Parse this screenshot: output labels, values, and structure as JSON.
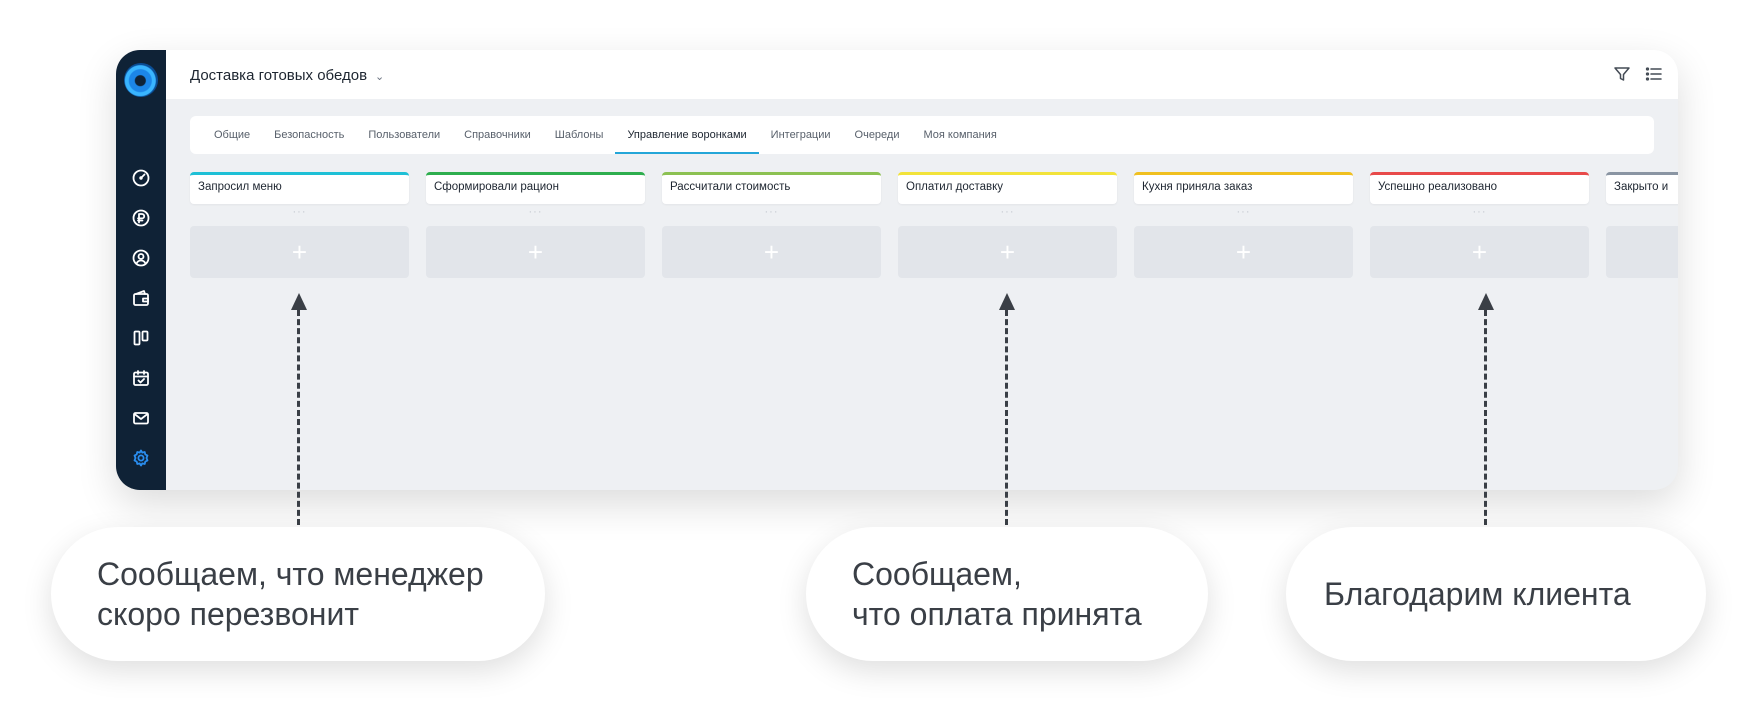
{
  "app": {
    "title": "Доставка готовых обедов",
    "title_caret": "⌄",
    "sidebar_icons": [
      "dashboard-icon",
      "ruble-icon",
      "user-icon",
      "wallet-icon",
      "kanban-icon",
      "calendar-icon",
      "mail-icon",
      "gear-icon"
    ],
    "active_sidebar_icon": "gear-icon",
    "top_icons": [
      "filter-icon",
      "list-icon"
    ]
  },
  "tabs": [
    {
      "label": "Общие"
    },
    {
      "label": "Безопасность"
    },
    {
      "label": "Пользователи"
    },
    {
      "label": "Справочники"
    },
    {
      "label": "Шаблоны"
    },
    {
      "label": "Управление воронками",
      "active": true
    },
    {
      "label": "Интеграции"
    },
    {
      "label": "Очереди"
    },
    {
      "label": "Моя компания"
    }
  ],
  "pipeline": {
    "dots": "···",
    "add_symbol": "+",
    "stages": [
      {
        "label": "Запросил меню",
        "color": "#1ec0d6"
      },
      {
        "label": "Сформировали рацион",
        "color": "#2eae4e"
      },
      {
        "label": "Рассчитали стоимость",
        "color": "#8cc152"
      },
      {
        "label": "Оплатил доставку",
        "color": "#f2e33a"
      },
      {
        "label": "Кухня приняла заказ",
        "color": "#f0c020"
      },
      {
        "label": "Успешно реализовано",
        "color": "#e84a4a"
      },
      {
        "label": "Закрыто и",
        "color": "#8a95a3"
      }
    ]
  },
  "annotations": [
    {
      "text": "Сообщаем, что менеджер\nскоро перезвонит"
    },
    {
      "text": "Сообщаем,\nчто оплата принята"
    },
    {
      "text": "Благодарим клиента"
    }
  ]
}
